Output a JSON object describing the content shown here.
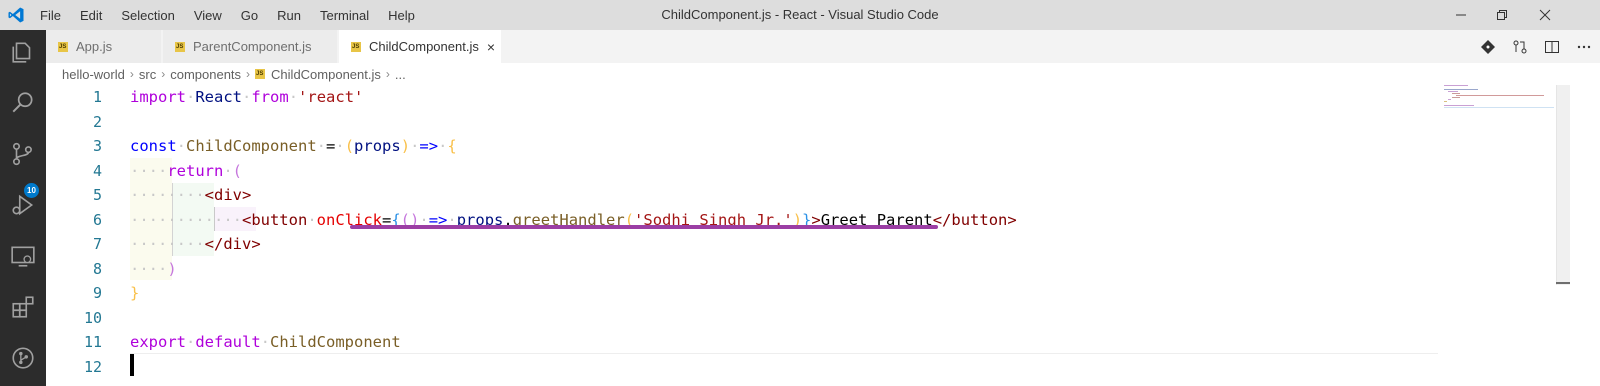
{
  "window": {
    "title": "ChildComponent.js - React - Visual Studio Code",
    "controls": [
      "minimize",
      "restore",
      "close"
    ]
  },
  "menu": [
    "File",
    "Edit",
    "Selection",
    "View",
    "Go",
    "Run",
    "Terminal",
    "Help"
  ],
  "activity_bar": {
    "items": [
      "explorer-icon",
      "search-icon",
      "source-control-icon",
      "run-debug-icon",
      "remote-explorer-icon",
      "extensions-icon",
      "git-graph-icon"
    ],
    "source_control_badge": "10"
  },
  "tabs": [
    {
      "label": "App.js",
      "active": false
    },
    {
      "label": "ParentComponent.js",
      "active": false
    },
    {
      "label": "ChildComponent.js",
      "active": true,
      "close": "×"
    }
  ],
  "breadcrumb": {
    "parts": [
      "hello-world",
      "src",
      "components",
      "ChildComponent.js",
      "..."
    ]
  },
  "editor": {
    "line_numbers": [
      "1",
      "2",
      "3",
      "4",
      "5",
      "6",
      "7",
      "8",
      "9",
      "10",
      "11",
      "12"
    ],
    "code_lines": [
      "import React from 'react'",
      "",
      "const ChildComponent = (props) => {",
      "    return (",
      "        <div>",
      "            <button onClick={() => props.greetHandler('Sodhi Singh Jr.')}>Greet Parent</button>",
      "        </div>",
      "    )",
      "}",
      "",
      "export default ChildComponent",
      ""
    ],
    "tokens": {
      "import": "import",
      "react_ident": "React",
      "from": "from",
      "react_str": "'react'",
      "const": "const",
      "component_name": "ChildComponent",
      "eq": "=",
      "paren_open": "(",
      "props": "props",
      "paren_close": ")",
      "arrow": "=>",
      "brace_open": "{",
      "return": "return",
      "div_open": "<div>",
      "button_open": "<button",
      "onclick_attr": "onClick",
      "attr_eq": "=",
      "empty_parens": "()",
      "props_ident": "props",
      "dot": ".",
      "handler": "greetHandler",
      "handler_arg": "'Sodhi Singh Jr.'",
      "close_brace_gt": "}",
      "gt": ">",
      "button_text": "Greet Parent",
      "button_close": "</button>",
      "div_close": "</div>",
      "close_paren": ")",
      "close_brace": "}",
      "export": "export",
      "default": "default"
    }
  },
  "colors": {
    "accent": "#007acc",
    "keyword": "#af00db",
    "keyword_blue": "#0000ff",
    "string": "#a31515",
    "annotation_underline": "#9b3ea4"
  }
}
